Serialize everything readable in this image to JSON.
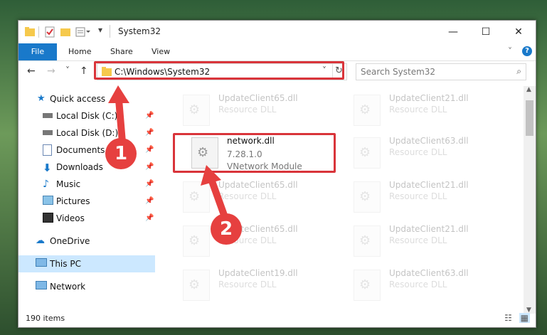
{
  "window": {
    "title": "System32",
    "minimize_label": "—",
    "maximize_label": "☐",
    "close_label": "✕"
  },
  "ribbon": {
    "tabs": [
      {
        "label": "File"
      },
      {
        "label": "Home"
      },
      {
        "label": "Share"
      },
      {
        "label": "View"
      }
    ],
    "expand_icon": "chevron-down-icon",
    "help_label": "?"
  },
  "nav": {
    "back_label": "←",
    "forward_label": "→",
    "recent_label": "˅",
    "up_label": "↑",
    "address": "C:\\Windows\\System32",
    "search_placeholder": "Search System32"
  },
  "sidebar": {
    "items": [
      {
        "label": "Quick access"
      },
      {
        "label": "Local Disk (C:)"
      },
      {
        "label": "Local Disk (D:)"
      },
      {
        "label": "Documents"
      },
      {
        "label": "Downloads"
      },
      {
        "label": "Music"
      },
      {
        "label": "Pictures"
      },
      {
        "label": "Videos"
      },
      {
        "label": "OneDrive"
      },
      {
        "label": "This PC"
      },
      {
        "label": "Network"
      }
    ]
  },
  "files": {
    "highlighted": {
      "name": "network.dll",
      "version": "7.28.1.0",
      "description": "VNetwork Module"
    },
    "background": [
      {
        "name": "UpdateClient65.dll",
        "type": "Resource DLL"
      },
      {
        "name": "UpdateClient21.dll",
        "type": "Resource DLL"
      },
      {
        "name": "UpdateClient63.dll",
        "type": "Resource DLL"
      },
      {
        "name": "UpdateClient65.dll",
        "type": "Resource DLL"
      },
      {
        "name": "UpdateClient21.dll",
        "type": "Resource DLL"
      },
      {
        "name": "UpdateClient65.dll",
        "type": "Resource DLL"
      },
      {
        "name": "UpdateClient21.dll",
        "type": "Resource DLL"
      },
      {
        "name": "UpdateClient19.dll",
        "type": "Resource DLL"
      },
      {
        "name": "UpdateClient63.dll",
        "type": "Resource DLL"
      }
    ]
  },
  "status": {
    "item_count": "190 items"
  },
  "annotations": {
    "step1": "1",
    "step2": "2"
  },
  "colors": {
    "accent": "#1979ca",
    "highlight": "#d9343a",
    "selection": "#cce8ff"
  }
}
